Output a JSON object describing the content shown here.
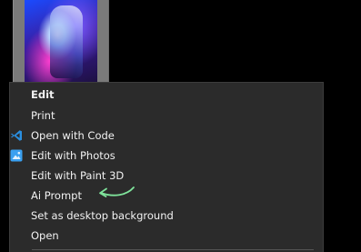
{
  "context_menu": {
    "items": [
      {
        "label": "Edit",
        "default": true,
        "icon": ""
      },
      {
        "label": "Print",
        "default": false,
        "icon": ""
      },
      {
        "label": "Open with Code",
        "default": false,
        "icon": "vscode-icon"
      },
      {
        "label": "Edit with Photos",
        "default": false,
        "icon": "photos-icon"
      },
      {
        "label": "Edit with Paint 3D",
        "default": false,
        "icon": ""
      },
      {
        "label": "Ai Prompt",
        "default": false,
        "icon": ""
      },
      {
        "label": "Set as desktop background",
        "default": false,
        "icon": ""
      },
      {
        "label": "Open",
        "default": false,
        "icon": ""
      }
    ]
  },
  "annotation": {
    "arrow_target": "Ai Prompt",
    "arrow_color": "#7fe39b"
  },
  "colors": {
    "menu_background": "#2b2b2b",
    "menu_text": "#f2f2f2",
    "vscode_blue": "#2a8fe0",
    "photos_blue": "#3aa0f0"
  }
}
